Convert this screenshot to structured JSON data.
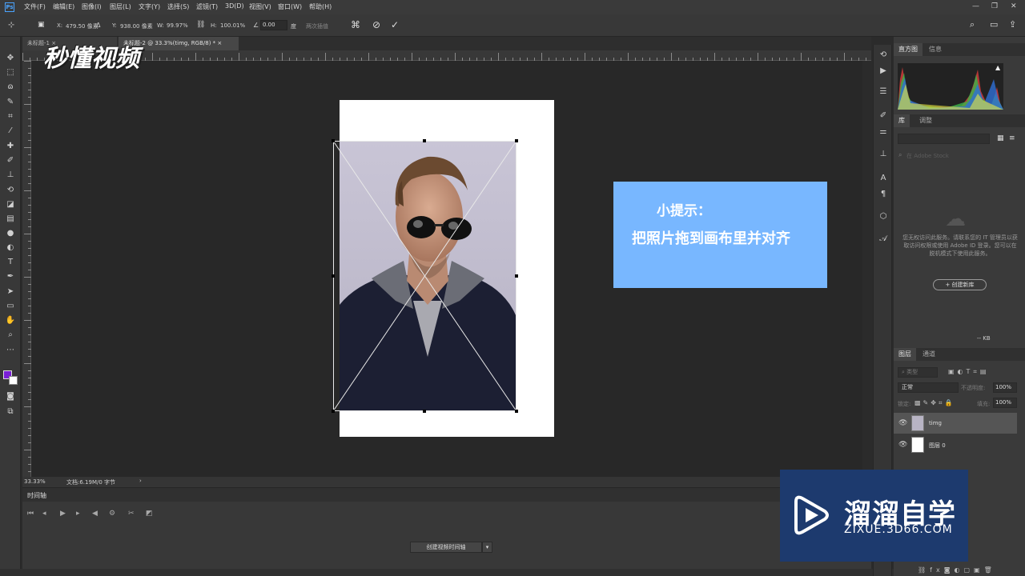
{
  "app": {
    "logo": "Ps",
    "menus": [
      "文件(F)",
      "编辑(E)",
      "图像(I)",
      "图层(L)",
      "文字(Y)",
      "选择(S)",
      "滤镜(T)",
      "3D(D)",
      "视图(V)",
      "窗口(W)",
      "帮助(H)"
    ]
  },
  "options": {
    "x_label": "X:",
    "x_value": "479.50 像素",
    "y_label": "Y:",
    "y_value": "938.00 像素",
    "w_label": "W:",
    "w_value": "99.97%",
    "h_label": "H:",
    "h_value": "100.01%",
    "angle_value": "0.00",
    "angle_unit": "度",
    "interp_label": "两次插值"
  },
  "tabs": [
    {
      "label": "未标题-1 ×"
    },
    {
      "label": "未标题-2 @ 33.3%(timg, RGB/8) * ×"
    }
  ],
  "brand": {
    "text": "秒懂视频"
  },
  "tip": {
    "title": "小提示：",
    "body": "把照片拖到画布里并对齐"
  },
  "status": {
    "zoom": "33.33%",
    "doc_info": "文档:6.19M/0 字节"
  },
  "timeline": {
    "title": "时间轴",
    "create_button": "创建视频时间轴"
  },
  "panels": {
    "histogram_tab": "直方图",
    "info_tab": "信息",
    "library_tab": "库",
    "adjust_tab": "调整",
    "library_search_placeholder": "在 Adobe Stock",
    "library_message": "您无权访问此服务。请联系您的 IT 管理员以获取访问权限或使用 Adobe ID 登录。您可以在脱机模式下使用此服务。",
    "library_create": "+ 创建新库",
    "library_size": "-- KB",
    "layers_tab": "图层",
    "channels_tab": "通道",
    "layer_filter": "类型",
    "blend_mode": "正常",
    "opacity_label": "不透明度:",
    "opacity_value": "100%",
    "lock_label": "锁定:",
    "fill_label": "填充:",
    "fill_value": "100%",
    "layers": [
      {
        "name": "timg"
      },
      {
        "name": "图层 0"
      }
    ]
  },
  "watermark": {
    "title": "溜溜自学",
    "url": "ZIXUE.3D66.COM"
  }
}
